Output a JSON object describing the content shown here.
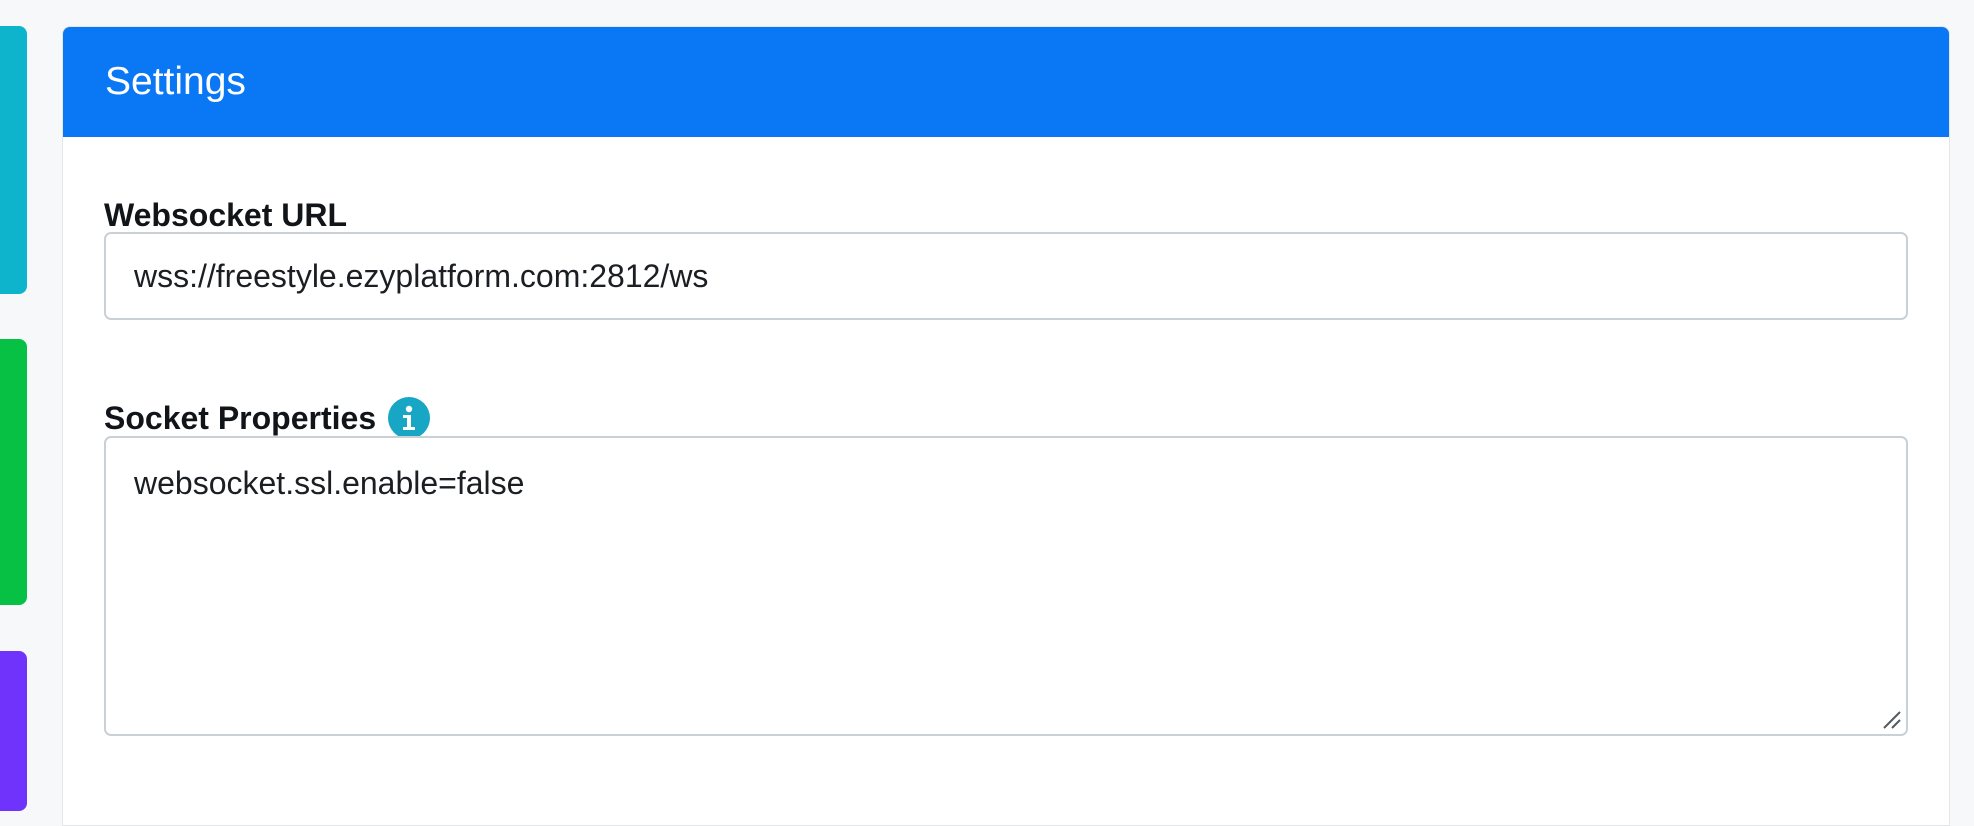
{
  "colors": {
    "header_bg": "#0a77f5",
    "accent_cyan": "#0db4cb",
    "accent_green": "#06c143",
    "accent_purple": "#6f33fb",
    "info_icon": "#17a6c4"
  },
  "panel": {
    "title": "Settings"
  },
  "fields": {
    "websocket_url": {
      "label": "Websocket URL",
      "value": "wss://freestyle.ezyplatform.com:2812/ws"
    },
    "socket_properties": {
      "label": "Socket Properties",
      "info_icon": "info-icon",
      "value": "websocket.ssl.enable=false"
    }
  }
}
